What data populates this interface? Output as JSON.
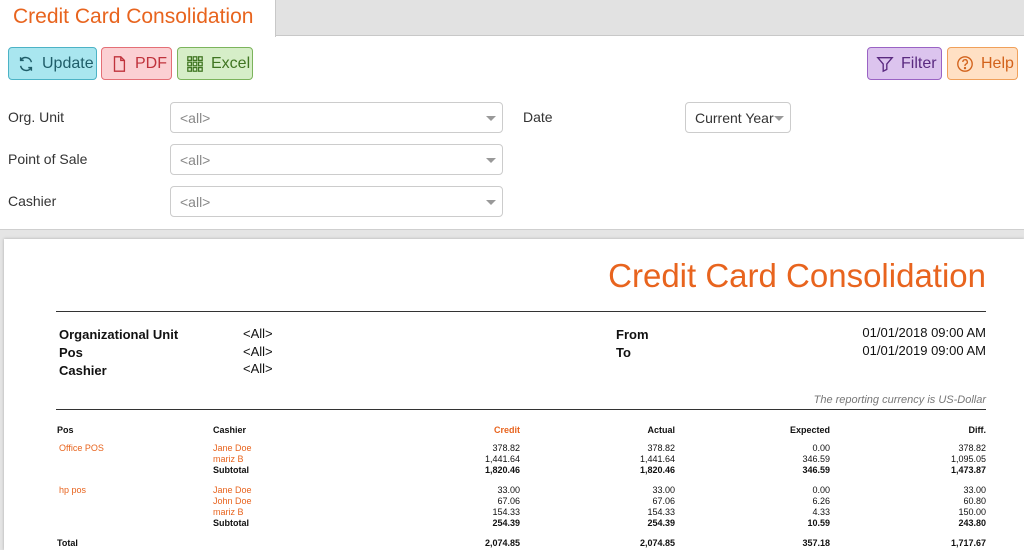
{
  "tab": {
    "title": "Credit Card Consolidation"
  },
  "toolbar": {
    "update": "Update",
    "pdf": "PDF",
    "excel": "Excel",
    "filter": "Filter",
    "help": "Help"
  },
  "filters": {
    "org_unit_label": "Org. Unit",
    "org_unit_value": "<all>",
    "pos_label": "Point of Sale",
    "pos_value": "<all>",
    "cashier_label": "Cashier",
    "cashier_value": "<all>",
    "date_label": "Date",
    "date_value": "Current Year"
  },
  "report": {
    "title": "Credit Card Consolidation",
    "org_label": "Organizational Unit",
    "org_value": "<All>",
    "pos_label": "Pos",
    "pos_value": "<All>",
    "cashier_label": "Cashier",
    "cashier_value": "<All>",
    "from_label": "From",
    "from_value": "01/01/2018 09:00 AM",
    "to_label": "To",
    "to_value": "01/01/2019 09:00 AM",
    "currency_note": "The reporting currency is US-Dollar",
    "columns": [
      "Pos",
      "Cashier",
      "Credit",
      "Actual",
      "Expected",
      "Diff."
    ],
    "groups": [
      {
        "pos": "Office POS",
        "rows": [
          {
            "cashier": "Jane Doe",
            "credit": "378.82",
            "actual": "378.82",
            "expected": "0.00",
            "diff": "378.82"
          },
          {
            "cashier": "mariz B",
            "credit": "1,441.64",
            "actual": "1,441.64",
            "expected": "346.59",
            "diff": "1,095.05"
          }
        ],
        "subtotal": {
          "label": "Subtotal",
          "credit": "1,820.46",
          "actual": "1,820.46",
          "expected": "346.59",
          "diff": "1,473.87"
        }
      },
      {
        "pos": "hp pos",
        "rows": [
          {
            "cashier": "Jane Doe",
            "credit": "33.00",
            "actual": "33.00",
            "expected": "0.00",
            "diff": "33.00"
          },
          {
            "cashier": "John Doe",
            "credit": "67.06",
            "actual": "67.06",
            "expected": "6.26",
            "diff": "60.80"
          },
          {
            "cashier": "mariz B",
            "credit": "154.33",
            "actual": "154.33",
            "expected": "4.33",
            "diff": "150.00"
          }
        ],
        "subtotal": {
          "label": "Subtotal",
          "credit": "254.39",
          "actual": "254.39",
          "expected": "10.59",
          "diff": "243.80"
        }
      }
    ],
    "total": {
      "label": "Total",
      "credit": "2,074.85",
      "actual": "2,074.85",
      "expected": "357.18",
      "diff": "1,717.67"
    }
  },
  "colors": {
    "accent": "#e8641e"
  }
}
